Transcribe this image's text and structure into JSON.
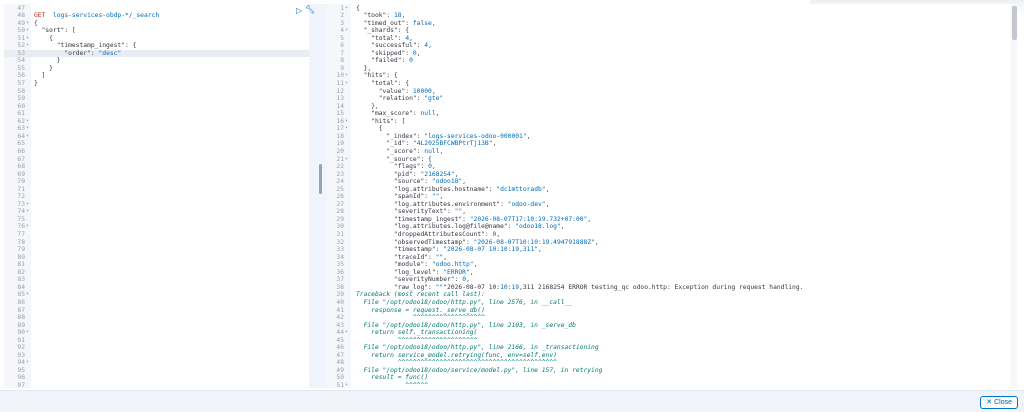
{
  "console": {
    "run_tooltip_icon": "play-icon",
    "settings_icon": "wrench-icon",
    "request_lines": [
      {
        "n": "47",
        "f": "",
        "c": ""
      },
      {
        "n": "48",
        "f": "",
        "c": "GET  logs-services-obdp-*/_search",
        "type": "req"
      },
      {
        "n": "49",
        "f": "▾",
        "c": "{"
      },
      {
        "n": "50",
        "f": "▾",
        "c": "  \"sort\": ["
      },
      {
        "n": "51",
        "f": "▾",
        "c": "    {"
      },
      {
        "n": "52",
        "f": "▾",
        "c": "      \"timestamp_ingest\": {"
      },
      {
        "n": "53",
        "f": "",
        "c": "        \"order\": \"desc\"",
        "hl": true
      },
      {
        "n": "54",
        "f": "",
        "c": "      }"
      },
      {
        "n": "55",
        "f": "",
        "c": "    }"
      },
      {
        "n": "56",
        "f": "",
        "c": "  ]"
      },
      {
        "n": "57",
        "f": "",
        "c": "}"
      },
      {
        "n": "58",
        "f": "",
        "c": ""
      },
      {
        "n": "59",
        "f": "",
        "c": ""
      },
      {
        "n": "60",
        "f": "",
        "c": ""
      },
      {
        "n": "61",
        "f": "",
        "c": ""
      },
      {
        "n": "62",
        "f": "▾",
        "c": ""
      },
      {
        "n": "63",
        "f": "▾",
        "c": ""
      },
      {
        "n": "64",
        "f": "▾",
        "c": ""
      },
      {
        "n": "65",
        "f": "",
        "c": ""
      },
      {
        "n": "66",
        "f": "",
        "c": ""
      },
      {
        "n": "67",
        "f": "",
        "c": ""
      },
      {
        "n": "68",
        "f": "",
        "c": ""
      },
      {
        "n": "69",
        "f": "",
        "c": ""
      },
      {
        "n": "70",
        "f": "",
        "c": ""
      },
      {
        "n": "71",
        "f": "",
        "c": ""
      },
      {
        "n": "72",
        "f": "",
        "c": ""
      },
      {
        "n": "73",
        "f": "▾",
        "c": ""
      },
      {
        "n": "74",
        "f": "▾",
        "c": ""
      },
      {
        "n": "75",
        "f": "",
        "c": ""
      },
      {
        "n": "76",
        "f": "▾",
        "c": ""
      },
      {
        "n": "77",
        "f": "",
        "c": ""
      },
      {
        "n": "78",
        "f": "",
        "c": ""
      },
      {
        "n": "79",
        "f": "",
        "c": ""
      },
      {
        "n": "80",
        "f": "",
        "c": ""
      },
      {
        "n": "81",
        "f": "",
        "c": ""
      },
      {
        "n": "82",
        "f": "",
        "c": ""
      },
      {
        "n": "83",
        "f": "",
        "c": ""
      },
      {
        "n": "84",
        "f": "",
        "c": ""
      },
      {
        "n": "85",
        "f": "▾",
        "c": ""
      },
      {
        "n": "86",
        "f": "",
        "c": ""
      },
      {
        "n": "87",
        "f": "",
        "c": ""
      },
      {
        "n": "88",
        "f": "",
        "c": ""
      },
      {
        "n": "89",
        "f": "",
        "c": ""
      },
      {
        "n": "90",
        "f": "▾",
        "c": ""
      },
      {
        "n": "91",
        "f": "",
        "c": ""
      },
      {
        "n": "92",
        "f": "",
        "c": ""
      },
      {
        "n": "93",
        "f": "",
        "c": ""
      },
      {
        "n": "94",
        "f": "▾",
        "c": ""
      },
      {
        "n": "95",
        "f": "",
        "c": ""
      },
      {
        "n": "96",
        "f": "",
        "c": ""
      },
      {
        "n": "97",
        "f": "",
        "c": ""
      },
      {
        "n": "98",
        "f": "▾",
        "c": ""
      }
    ],
    "response_lines": [
      {
        "n": "1",
        "f": "▾",
        "c": "{"
      },
      {
        "n": "2",
        "f": "",
        "c": "  \"took\": 18,"
      },
      {
        "n": "3",
        "f": "",
        "c": "  \"timed_out\": false,"
      },
      {
        "n": "4",
        "f": "▾",
        "c": "  \"_shards\": {"
      },
      {
        "n": "5",
        "f": "",
        "c": "    \"total\": 4,"
      },
      {
        "n": "6",
        "f": "",
        "c": "    \"successful\": 4,"
      },
      {
        "n": "7",
        "f": "",
        "c": "    \"skipped\": 0,"
      },
      {
        "n": "8",
        "f": "",
        "c": "    \"failed\": 0"
      },
      {
        "n": "9",
        "f": "",
        "c": "  },"
      },
      {
        "n": "10",
        "f": "▾",
        "c": "  \"hits\": {"
      },
      {
        "n": "11",
        "f": "▾",
        "c": "    \"total\": {"
      },
      {
        "n": "12",
        "f": "",
        "c": "      \"value\": 10000,"
      },
      {
        "n": "13",
        "f": "",
        "c": "      \"relation\": \"gte\""
      },
      {
        "n": "14",
        "f": "",
        "c": "    },"
      },
      {
        "n": "15",
        "f": "",
        "c": "    \"max_score\": null,"
      },
      {
        "n": "16",
        "f": "▾",
        "c": "    \"hits\": ["
      },
      {
        "n": "17",
        "f": "▾",
        "c": "      {"
      },
      {
        "n": "18",
        "f": "",
        "c": "        \"_index\": \"logs-services-odoo-000001\","
      },
      {
        "n": "19",
        "f": "",
        "c": "        \"_id\": \"4L2025BFCWBPtrTj13B\","
      },
      {
        "n": "20",
        "f": "",
        "c": "        \"_score\": null,"
      },
      {
        "n": "21",
        "f": "▾",
        "c": "        \"_source\": {"
      },
      {
        "n": "22",
        "f": "",
        "c": "          \"flags\": 0,"
      },
      {
        "n": "23",
        "f": "",
        "c": "          \"pid\": \"2168254\","
      },
      {
        "n": "24",
        "f": "",
        "c": "          \"source\": \"odoo18\","
      },
      {
        "n": "25",
        "f": "",
        "c": "          \"log.attributes.hostname\": \"dc1mttoradb\","
      },
      {
        "n": "26",
        "f": "",
        "c": "          \"spanId\": \"\","
      },
      {
        "n": "27",
        "f": "",
        "c": "          \"log.attributes.environment\": \"odoo-dev\","
      },
      {
        "n": "28",
        "f": "",
        "c": "          \"severityText\": \"\","
      },
      {
        "n": "29",
        "f": "",
        "c": "          \"timestamp_ingest\": \"2026-08-07T17:10:19.732+07:00\","
      },
      {
        "n": "30",
        "f": "",
        "c": "          \"log.attributes.log@file@name\": \"odoo18.log\","
      },
      {
        "n": "31",
        "f": "",
        "c": "          \"droppedAttributesCount\": 0,"
      },
      {
        "n": "32",
        "f": "",
        "c": "          \"observedTimestamp\": \"2026-08-07T10:10:19.494791888Z\","
      },
      {
        "n": "33",
        "f": "",
        "c": "          \"timestamp\": \"2026-08-07 10:10:19,311\","
      },
      {
        "n": "34",
        "f": "",
        "c": "          \"traceId\": \"\","
      },
      {
        "n": "35",
        "f": "",
        "c": "          \"module\": \"odoo.http\","
      },
      {
        "n": "36",
        "f": "",
        "c": "          \"log_level\": \"ERROR\","
      },
      {
        "n": "37",
        "f": "",
        "c": "          \"severityNumber\": 0,"
      },
      {
        "n": "38",
        "f": "",
        "c": "          \"raw_log\": \"\"\"2026-08-07 10:10:19,311 2168254 ERROR testing_qc odoo.http: Exception during request handling."
      },
      {
        "n": "39",
        "f": "",
        "c": "Traceback (most recent call last):",
        "g": true
      },
      {
        "n": "40",
        "f": "",
        "c": "  File \"/opt/odoo18/odoo/http.py\", line 2576, in __call__",
        "g": true
      },
      {
        "n": "41",
        "f": "",
        "c": "    response = request._serve_db()",
        "g": true
      },
      {
        "n": "42",
        "f": "",
        "c": "               ^^^^^^^^^^^^^^^^^^^",
        "g": true
      },
      {
        "n": "43",
        "f": "",
        "c": "  File \"/opt/odoo18/odoo/http.py\", line 2103, in _serve_db",
        "g": true
      },
      {
        "n": "44",
        "f": "▾",
        "c": "    return self._transactioning(",
        "g": true
      },
      {
        "n": "45",
        "f": "",
        "c": "           ^^^^^^^^^^^^^^^^^^^^^",
        "g": true
      },
      {
        "n": "46",
        "f": "",
        "c": "  File \"/opt/odoo18/odoo/http.py\", line 2166, in _transactioning",
        "g": true
      },
      {
        "n": "47",
        "f": "",
        "c": "    return service_model.retrying(func, env=self.env)",
        "g": true
      },
      {
        "n": "48",
        "f": "",
        "c": "           ^^^^^^^^^^^^^^^^^^^^^^^^^^^^^^^^^^^^^^^^^^",
        "g": true
      },
      {
        "n": "49",
        "f": "",
        "c": "  File \"/opt/odoo18/odoo/service/model.py\", line 157, in retrying",
        "g": true
      },
      {
        "n": "50",
        "f": "",
        "c": "    result = func()",
        "g": true
      },
      {
        "n": "51",
        "f": "▾",
        "c": "             ^^^^^^",
        "g": true
      }
    ]
  },
  "footer": {
    "close_label": "Close",
    "close_icon": "close-icon"
  }
}
